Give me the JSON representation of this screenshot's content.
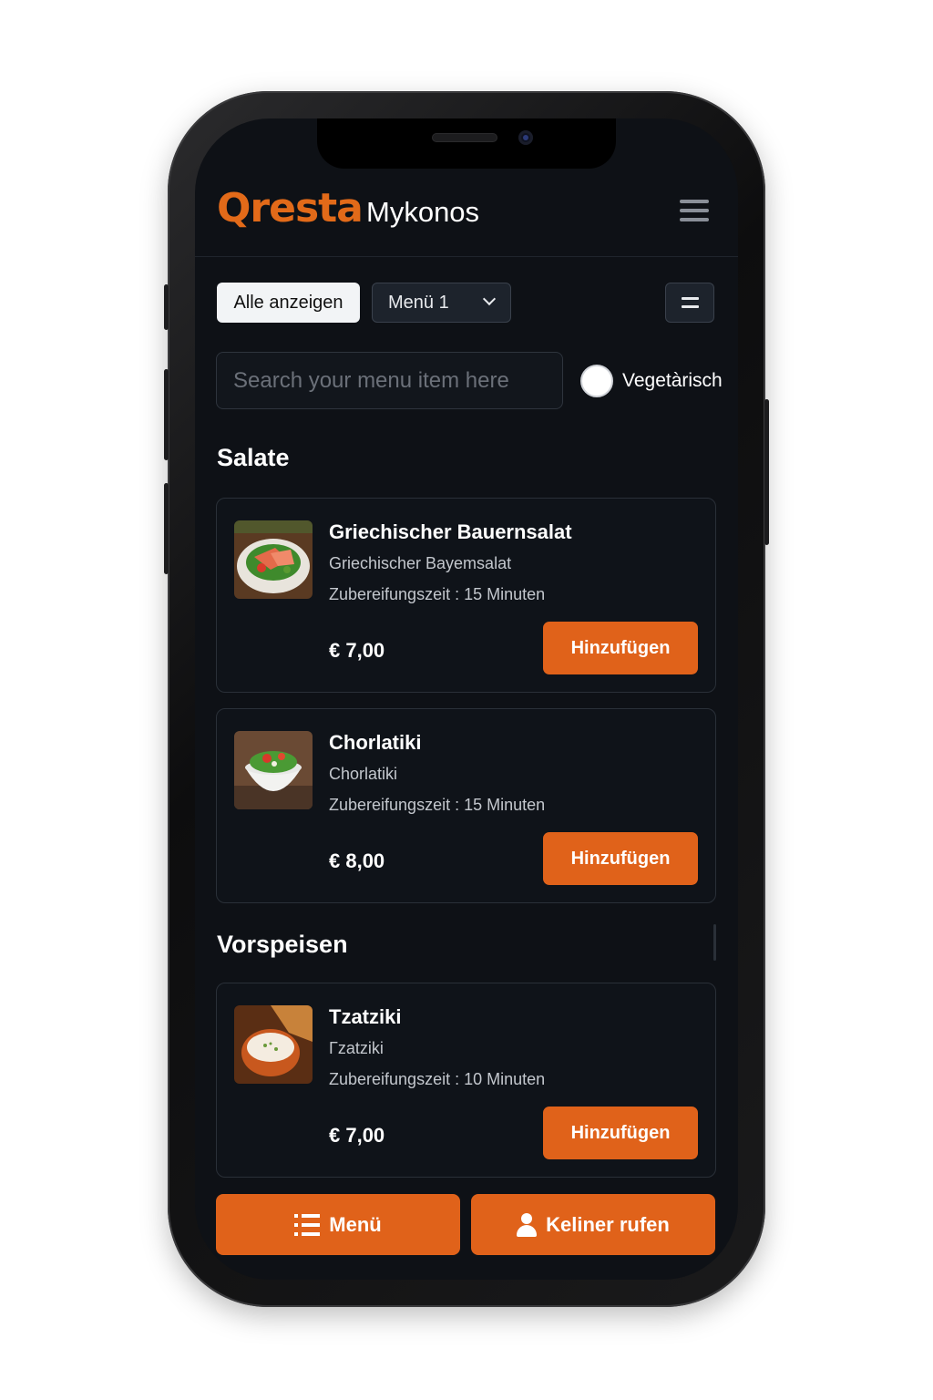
{
  "header": {
    "logo_text": "Qresta",
    "restaurant_name": "Mykonos",
    "menu_icon": "hamburger-icon"
  },
  "filters": {
    "show_all_label": "Alle anzeigen",
    "menu_select_value": "Menü 1",
    "view_toggle_icon": "equals-icon"
  },
  "search": {
    "placeholder": "Search your menu item here",
    "vegetarian_label": "Vegetàrisch"
  },
  "sections": [
    {
      "title": "Salate",
      "items": [
        {
          "name": "Griechischer Bauernsalat",
          "description": "Griechischer Bayemsalat",
          "prep_time": "Zubereifungszeit : 15 Minuten",
          "price": "€ 7,00",
          "add_label": "Hinzufügen"
        },
        {
          "name": "Chorlatiki",
          "description": "Chorlatiki",
          "prep_time": "Zubereifungszeit : 15 Minuten",
          "price": "€ 8,00",
          "add_label": "Hinzufügen"
        }
      ]
    },
    {
      "title": "Vorspeisen",
      "items": [
        {
          "name": "Tzatziki",
          "description": "Γzatziki",
          "prep_time": "Zubereifungszeit : 10 Minuten",
          "price": "€ 7,00",
          "add_label": "Hinzufügen"
        }
      ]
    }
  ],
  "bottom_bar": {
    "menu_label": "Menü",
    "menu_icon": "list-icon",
    "waiter_label": "Keliner rufen",
    "waiter_icon": "user-icon"
  },
  "colors": {
    "accent": "#e0621a",
    "background": "#0e1116"
  }
}
